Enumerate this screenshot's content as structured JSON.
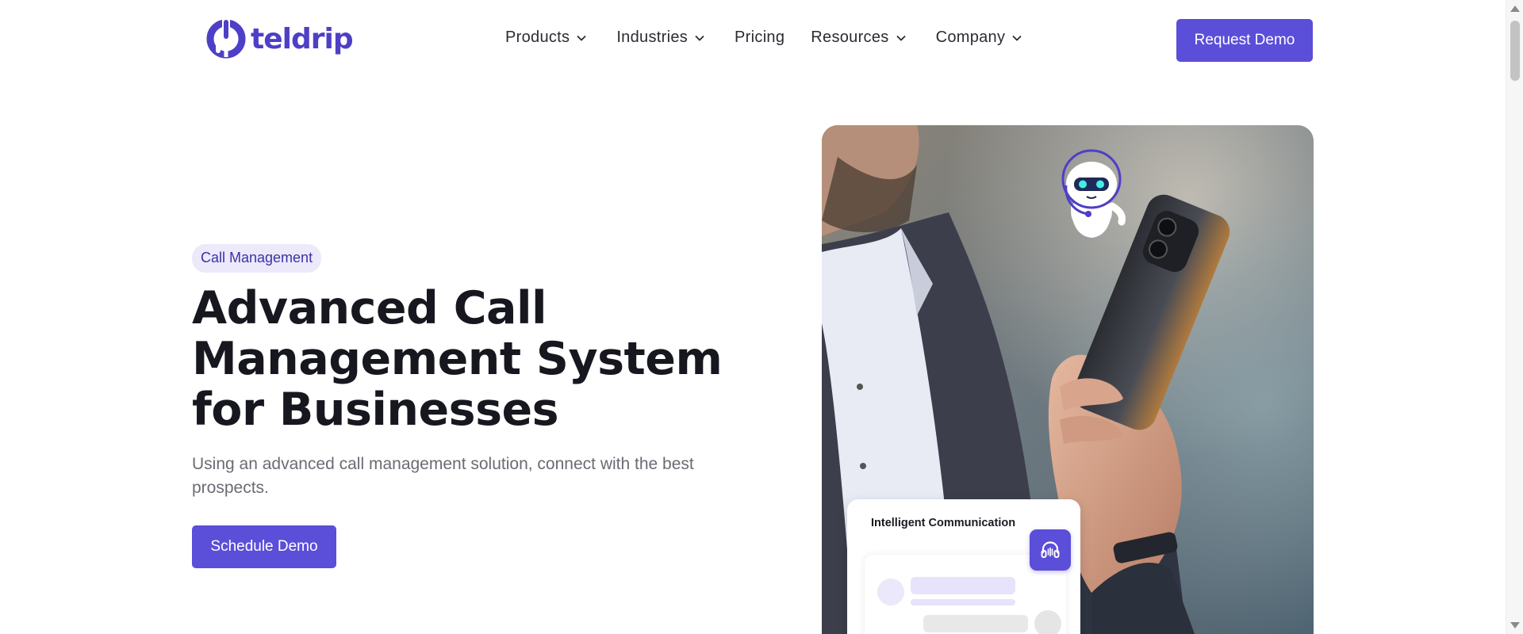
{
  "brand": {
    "name": "teldrip",
    "color": "#4e3fc7",
    "logo_icon": "teldrip-logo-icon"
  },
  "nav": {
    "items": [
      {
        "label": "Products",
        "has_dropdown": true
      },
      {
        "label": "Industries",
        "has_dropdown": true
      },
      {
        "label": "Pricing",
        "has_dropdown": false
      },
      {
        "label": "Resources",
        "has_dropdown": true
      },
      {
        "label": "Company",
        "has_dropdown": true
      }
    ],
    "cta_label": "Request Demo"
  },
  "hero": {
    "tag": "Call Management",
    "title": "Advanced Call Management System for Businesses",
    "subtitle": "Using an advanced call management solution, connect with the best prospects.",
    "cta_label": "Schedule Demo"
  },
  "image_card": {
    "title": "Intelligent Communication",
    "icon": "headset-icon"
  },
  "colors": {
    "accent": "#5b4ed8",
    "tag_bg": "#ece9fb",
    "tag_text": "#3c32a3",
    "heading": "#17171f",
    "body_text": "#6b6b74"
  }
}
